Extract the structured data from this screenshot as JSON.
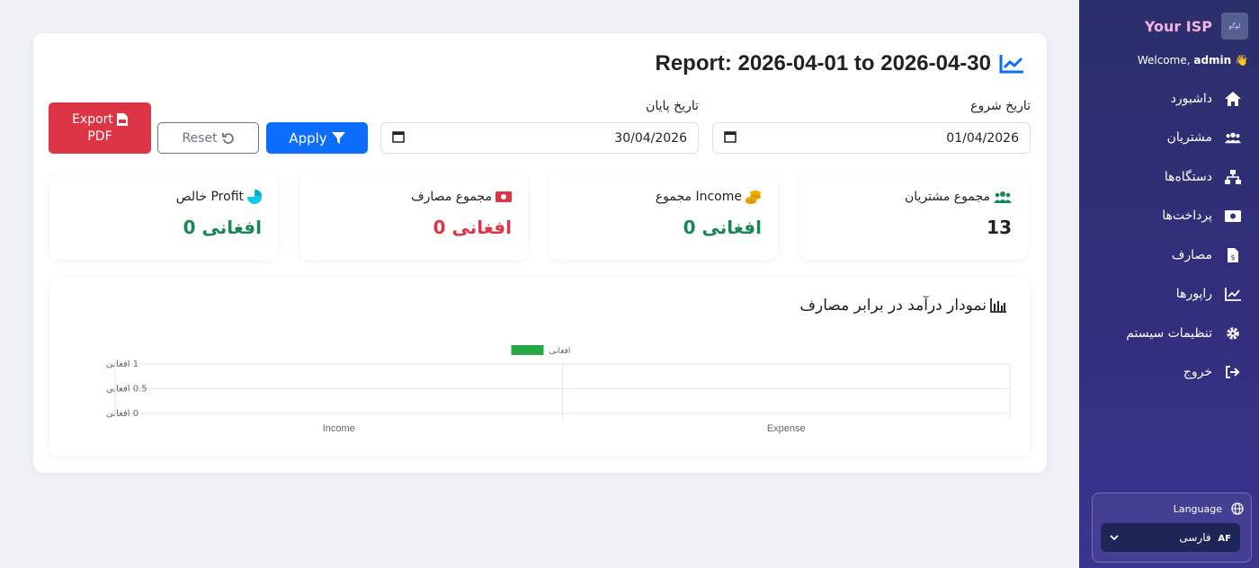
{
  "sidebar": {
    "brand": "Your ISP",
    "brand_logo": "لوگو",
    "welcome_prefix": "Welcome,",
    "welcome_user": "admin",
    "welcome_emoji": "👋",
    "items": [
      {
        "label": "داشبورد",
        "icon": "home-icon"
      },
      {
        "label": "مشتریان",
        "icon": "users-icon"
      },
      {
        "label": "دستگاه‌ها",
        "icon": "network-icon"
      },
      {
        "label": "پرداخت‌ها",
        "icon": "money-icon"
      },
      {
        "label": "مصارف",
        "icon": "invoice-icon"
      },
      {
        "label": "راپورها",
        "icon": "chart-line-icon"
      },
      {
        "label": "تنظیمات سیستم",
        "icon": "gear-icon"
      },
      {
        "label": "خروج",
        "icon": "logout-icon"
      }
    ],
    "language": {
      "label": "Language",
      "selected_code": "AF",
      "selected_name": "فارسی"
    }
  },
  "report": {
    "title": "Report: 2026-04-01 to 2026-04-30",
    "start_label": "تاریخ شروع",
    "start_value": "01/04/2026",
    "end_label": "تاریخ پایان",
    "end_value": "30/04/2026",
    "apply_label": "Apply",
    "reset_label": "Reset",
    "export_label": "Export",
    "export_label2": "PDF"
  },
  "stats": [
    {
      "label": "مجموع مشتریان",
      "value": "13",
      "icon": "users-icon",
      "color": "#198754"
    },
    {
      "label": "مجموع Income",
      "value": "0 افغانی",
      "icon": "coins-icon",
      "color": "#f0ad00"
    },
    {
      "label": "مجموع مصارف",
      "value": "0 افغانی",
      "icon": "money-bill-icon",
      "color": "#dc3545"
    },
    {
      "label": "خالص Profit",
      "value": "0 افغانی",
      "icon": "pie-chart-icon",
      "color": "#0dcaf0"
    }
  ],
  "chart": {
    "title": "نمودار درآمد در برابر مصارف"
  },
  "chart_data": {
    "type": "bar",
    "categories": [
      "Income",
      "Expense"
    ],
    "series": [
      {
        "name": "افغانی",
        "values": [
          0,
          0
        ],
        "color": "#28a745"
      }
    ],
    "ylim": [
      0,
      1
    ],
    "yticks": [
      {
        "v": 0,
        "label": "0 افغانی"
      },
      {
        "v": 0.5,
        "label": "0.5 افغانی"
      },
      {
        "v": 1,
        "label": "1 افغانی"
      }
    ],
    "grid": true,
    "legend": "top-center"
  },
  "colors": {
    "primary": "#0d6efd",
    "danger": "#dc3545",
    "success": "#198754",
    "sidebar": "#2b2f6b"
  }
}
